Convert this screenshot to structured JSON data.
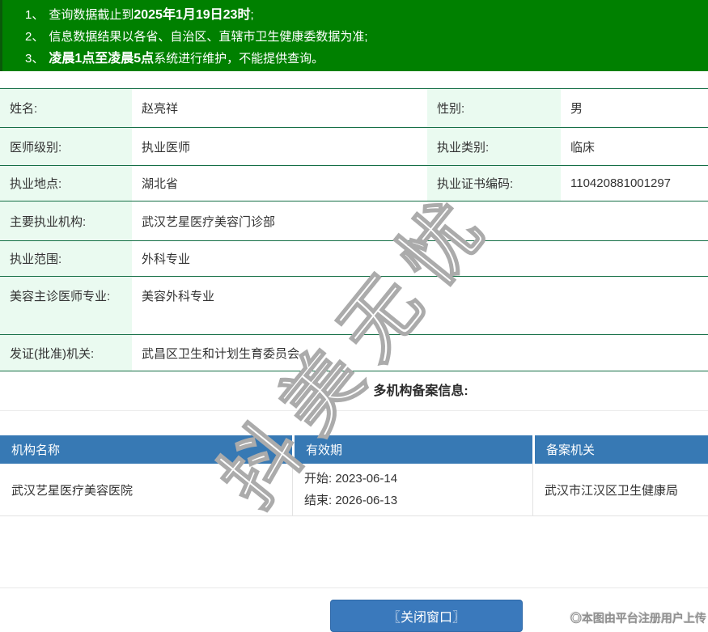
{
  "colors": {
    "banner_green": "#008000",
    "info_border_green": "#156f46",
    "label_bg_mint": "#eafaf0",
    "table_header_blue": "#3779b4",
    "button_blue": "#3a79bc"
  },
  "banner": {
    "notices": [
      {
        "num": "1、",
        "pre": "查询数据截止到",
        "bold": "2025年1月19日23时",
        "post": ";"
      },
      {
        "num": "2、",
        "pre": "信息数据结果以各省、自治区、直辖市卫生健康委数据为准;",
        "bold": "",
        "post": ""
      },
      {
        "num": "3、",
        "pre": "",
        "bold": "凌晨1点至凌晨5点",
        "post": "系统进行维护，不能提供查询。"
      }
    ]
  },
  "info": {
    "rows": [
      {
        "label1": "姓名:",
        "value1": "赵亮祥",
        "label2": "性别:",
        "value2": "男"
      },
      {
        "label1": "医师级别:",
        "value1": "执业医师",
        "label2": "执业类别:",
        "value2": "临床"
      },
      {
        "label1": "执业地点:",
        "value1": "湖北省",
        "label2": "执业证书编码:",
        "value2": "110420881001297"
      },
      {
        "label": "主要执业机构:",
        "value": "武汉艺星医疗美容门诊部"
      },
      {
        "label": "执业范围:",
        "value": "外科专业"
      },
      {
        "label": "美容主诊医师专业:",
        "value": "美容外科专业"
      },
      {
        "label": "发证(批准)机关:",
        "value": "武昌区卫生和计划生育委员会"
      }
    ]
  },
  "filing": {
    "section_title": "多机构备案信息:",
    "headers": [
      "机构名称",
      "有效期",
      "备案机关"
    ],
    "row": {
      "name": "武汉艺星医疗美容医院",
      "validity_start": "开始: 2023-06-14",
      "validity_end": "结束: 2026-06-13",
      "authority": "武汉市江汉区卫生健康局"
    }
  },
  "footer": {
    "close_button": "〖关闭窗口〗",
    "note": "◎本图由平台注册用户上传"
  },
  "watermark": "抖美无忧"
}
